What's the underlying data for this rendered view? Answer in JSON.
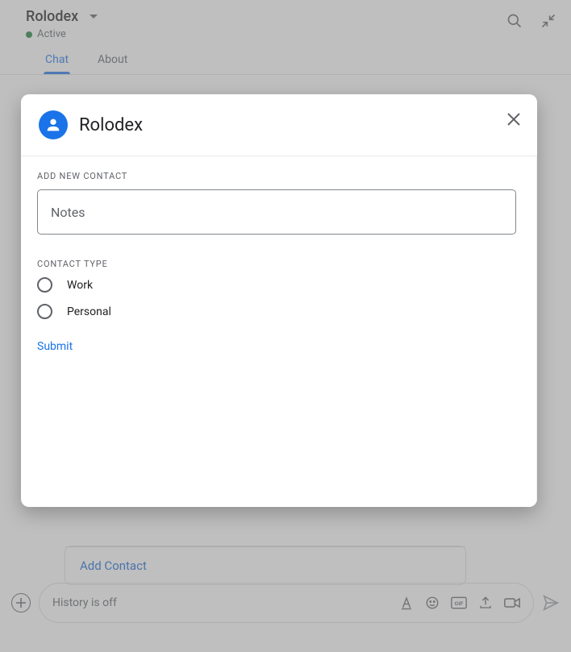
{
  "header": {
    "title": "Rolodex",
    "status": "Active"
  },
  "tabs": [
    {
      "label": "Chat",
      "active": true
    },
    {
      "label": "About",
      "active": false
    }
  ],
  "card": {
    "action_label": "Add Contact"
  },
  "composer": {
    "placeholder": "History is off"
  },
  "dialog": {
    "title": "Rolodex",
    "section_label": "ADD NEW CONTACT",
    "notes_placeholder": "Notes",
    "contact_type_label": "CONTACT TYPE",
    "options": [
      {
        "label": "Work"
      },
      {
        "label": "Personal"
      }
    ],
    "submit_label": "Submit"
  }
}
